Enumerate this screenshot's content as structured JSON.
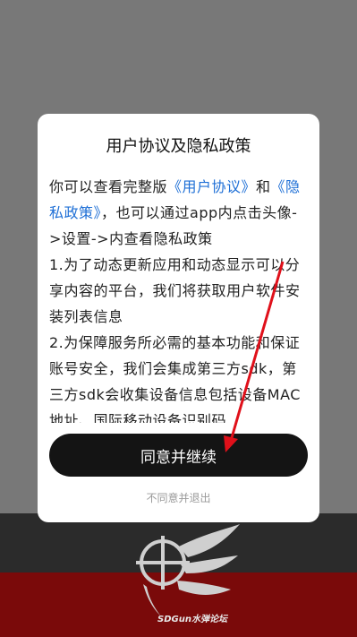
{
  "dialog": {
    "title": "用户协议及隐私政策",
    "intro_prefix": "你可以查看完整版",
    "user_agreement_link": "《用户协议》",
    "intro_and": "和",
    "privacy_policy_link": "《隐私政策》",
    "intro_suffix": "，也可以通过app内点击头像->设置->内查看隐私政策",
    "item1": "1.为了动态更新应用和动态显示可以分享内容的平台，我们将获取用户软件安装列表信息",
    "item2": "2.为保障服务所必需的基本功能和保证账号安全，我们会集成第三方sdk，第三方sdk会收集设备信息包括设备MAC地址、国际移动设备识别码",
    "agree_button": "同意并继续",
    "decline_link": "不同意并退出"
  },
  "background": {
    "watermark_text": "SDGun水弹论坛"
  },
  "colors": {
    "link": "#1e6fd6",
    "annotation_arrow": "#e0101a",
    "button_bg": "#141414",
    "footer_red": "#7a0a0a"
  }
}
